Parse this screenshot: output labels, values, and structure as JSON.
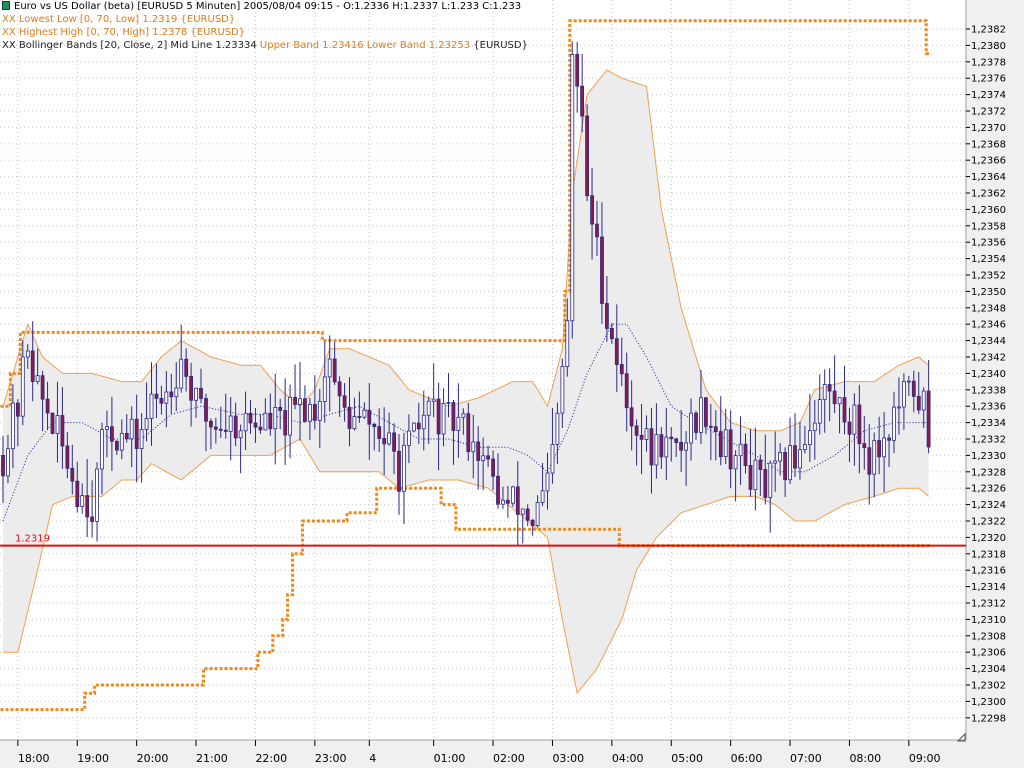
{
  "legend": {
    "title_line": "Euro vs US Dollar (beta) [EURUSD  5 Minuten] 2005/08/04 09:15 - O:1.2336 H:1.2337 L:1.233 C:1.233",
    "lowest_low": "Lowest Low [0, 70, Low] 1.2319 {EURUSD}",
    "highest_high": "Highest High [0, 70, High] 1.2378 {EURUSD}",
    "bollinger_prefix": "Bollinger Bands [20, Close, 2] Mid Line 1.23334 ",
    "bollinger_bands": "Upper Band 1.23416 Lower Band 1.23253",
    "bollinger_suffix": " {EURUSD}",
    "item_marker": "XX"
  },
  "colors": {
    "up_candle": "#ffffff",
    "down_candle": "#8b1a4a",
    "candle_wick": "#2a2a8a",
    "band_line": "#f0a050",
    "band_fill": "#ececec",
    "midline": "#1a1a9a",
    "channel": "#ee8a1a",
    "ref_line": "#e01010",
    "grid": "#c8c8c8",
    "axis_bg": "#f0f0f0"
  },
  "chart_data": {
    "type": "candlestick",
    "title": "Euro vs US Dollar (beta) [EURUSD  5 Minuten]",
    "ylim": [
      1.2296,
      1.2384
    ],
    "y_ticks": [
      1.2298,
      1.23,
      1.2302,
      1.2304,
      1.2306,
      1.2308,
      1.231,
      1.2312,
      1.2314,
      1.2316,
      1.2318,
      1.232,
      1.2322,
      1.2324,
      1.2326,
      1.2328,
      1.233,
      1.2332,
      1.2334,
      1.2336,
      1.2338,
      1.234,
      1.2342,
      1.2344,
      1.2346,
      1.2348,
      1.235,
      1.2352,
      1.2354,
      1.2356,
      1.2358,
      1.236,
      1.2362,
      1.2364,
      1.2366,
      1.2368,
      1.237,
      1.2372,
      1.2374,
      1.2376,
      1.2378,
      1.238,
      1.2382
    ],
    "y_tick_labels": [
      "1,2298",
      "1,2300",
      "1,2302",
      "1,2304",
      "1,2306",
      "1,2308",
      "1,2310",
      "1,2312",
      "1,2314",
      "1,2316",
      "1,2318",
      "1,2320",
      "1,2322",
      "1,2324",
      "1,2326",
      "1,2328",
      "1,2330",
      "1,2332",
      "1,2334",
      "1,2336",
      "1,2338",
      "1,2340",
      "1,2342",
      "1,2344",
      "1,2346",
      "1,2348",
      "1,2350",
      "1,2352",
      "1,2354",
      "1,2356",
      "1,2358",
      "1,2360",
      "1,2362",
      "1,2364",
      "1,2366",
      "1,2368",
      "1,2370",
      "1,2372",
      "1,2374",
      "1,2376",
      "1,2378",
      "1,2380",
      "1,2382"
    ],
    "x_ticks": [
      "18:00",
      "19:00",
      "20:00",
      "21:00",
      "22:00",
      "23:00",
      "4",
      "01:00",
      "02:00",
      "03:00",
      "04:00",
      "05:00",
      "06:00",
      "07:00",
      "08:00",
      "09:00"
    ],
    "x_tick_bars": [
      3,
      15,
      27,
      39,
      51,
      63,
      74,
      87,
      99,
      111,
      123,
      135,
      147,
      159,
      171,
      183
    ],
    "n_bars": 188,
    "reference_line": {
      "value": 1.2319,
      "label": "1.2319"
    },
    "anchors": {
      "close": [
        [
          0,
          1.233
        ],
        [
          3,
          1.2336
        ],
        [
          5,
          1.2344
        ],
        [
          7,
          1.2338
        ],
        [
          10,
          1.2334
        ],
        [
          15,
          1.2326
        ],
        [
          18,
          1.2324
        ],
        [
          21,
          1.2334
        ],
        [
          24,
          1.2332
        ],
        [
          27,
          1.2332
        ],
        [
          30,
          1.2336
        ],
        [
          33,
          1.2338
        ],
        [
          36,
          1.2342
        ],
        [
          39,
          1.2336
        ],
        [
          42,
          1.2334
        ],
        [
          45,
          1.2334
        ],
        [
          48,
          1.2334
        ],
        [
          51,
          1.2334
        ],
        [
          54,
          1.2334
        ],
        [
          57,
          1.2334
        ],
        [
          60,
          1.2336
        ],
        [
          63,
          1.2336
        ],
        [
          66,
          1.2342
        ],
        [
          68,
          1.2336
        ],
        [
          71,
          1.2334
        ],
        [
          74,
          1.2334
        ],
        [
          77,
          1.2332
        ],
        [
          80,
          1.2328
        ],
        [
          83,
          1.2332
        ],
        [
          86,
          1.2336
        ],
        [
          89,
          1.2334
        ],
        [
          92,
          1.2334
        ],
        [
          95,
          1.2332
        ],
        [
          98,
          1.2328
        ],
        [
          101,
          1.2324
        ],
        [
          104,
          1.2324
        ],
        [
          107,
          1.2322
        ],
        [
          110,
          1.2326
        ],
        [
          112,
          1.2334
        ],
        [
          114,
          1.2346
        ],
        [
          115,
          1.2378
        ],
        [
          116,
          1.2375
        ],
        [
          117,
          1.237
        ],
        [
          118,
          1.2362
        ],
        [
          120,
          1.2355
        ],
        [
          122,
          1.2347
        ],
        [
          124,
          1.2342
        ],
        [
          126,
          1.2336
        ],
        [
          128,
          1.2334
        ],
        [
          131,
          1.233
        ],
        [
          133,
          1.2332
        ],
        [
          136,
          1.233
        ],
        [
          139,
          1.2334
        ],
        [
          142,
          1.2336
        ],
        [
          145,
          1.2332
        ],
        [
          148,
          1.233
        ],
        [
          151,
          1.2328
        ],
        [
          154,
          1.2326
        ],
        [
          157,
          1.2328
        ],
        [
          160,
          1.233
        ],
        [
          163,
          1.2334
        ],
        [
          166,
          1.2338
        ],
        [
          169,
          1.2336
        ],
        [
          172,
          1.2334
        ],
        [
          175,
          1.233
        ],
        [
          178,
          1.2332
        ],
        [
          181,
          1.2336
        ],
        [
          184,
          1.2338
        ],
        [
          186,
          1.2336
        ],
        [
          187,
          1.233
        ]
      ],
      "upper_band": [
        [
          0,
          1.2336
        ],
        [
          3,
          1.2342
        ],
        [
          5,
          1.2346
        ],
        [
          8,
          1.2342
        ],
        [
          12,
          1.234
        ],
        [
          18,
          1.234
        ],
        [
          24,
          1.2339
        ],
        [
          28,
          1.2339
        ],
        [
          32,
          1.2342
        ],
        [
          36,
          1.2344
        ],
        [
          42,
          1.2342
        ],
        [
          48,
          1.2341
        ],
        [
          52,
          1.2341
        ],
        [
          56,
          1.2338
        ],
        [
          60,
          1.2336
        ],
        [
          63,
          1.2338
        ],
        [
          66,
          1.2343
        ],
        [
          70,
          1.2343
        ],
        [
          74,
          1.2342
        ],
        [
          78,
          1.2341
        ],
        [
          82,
          1.2338
        ],
        [
          86,
          1.2337
        ],
        [
          90,
          1.2336
        ],
        [
          96,
          1.2337
        ],
        [
          103,
          1.2339
        ],
        [
          107,
          1.2339
        ],
        [
          110,
          1.2336
        ],
        [
          113,
          1.2343
        ],
        [
          115,
          1.2362
        ],
        [
          118,
          1.2374
        ],
        [
          122,
          1.2377
        ],
        [
          125,
          1.2376
        ],
        [
          130,
          1.2375
        ],
        [
          133,
          1.236
        ],
        [
          137,
          1.2348
        ],
        [
          142,
          1.2338
        ],
        [
          147,
          1.2334
        ],
        [
          152,
          1.2333
        ],
        [
          157,
          1.2333
        ],
        [
          161,
          1.2334
        ],
        [
          164,
          1.2338
        ],
        [
          170,
          1.2339
        ],
        [
          176,
          1.2339
        ],
        [
          181,
          1.2341
        ],
        [
          185,
          1.2342
        ],
        [
          187,
          1.2341
        ]
      ],
      "lower_band": [
        [
          0,
          1.2306
        ],
        [
          3,
          1.2306
        ],
        [
          7,
          1.2316
        ],
        [
          10,
          1.2324
        ],
        [
          14,
          1.2325
        ],
        [
          20,
          1.2325
        ],
        [
          24,
          1.2327
        ],
        [
          27,
          1.2327
        ],
        [
          30,
          1.2329
        ],
        [
          36,
          1.2327
        ],
        [
          42,
          1.233
        ],
        [
          48,
          1.233
        ],
        [
          54,
          1.233
        ],
        [
          60,
          1.2332
        ],
        [
          64,
          1.2328
        ],
        [
          68,
          1.2328
        ],
        [
          72,
          1.2328
        ],
        [
          76,
          1.2328
        ],
        [
          80,
          1.2326
        ],
        [
          86,
          1.2327
        ],
        [
          92,
          1.2327
        ],
        [
          98,
          1.2326
        ],
        [
          102,
          1.2324
        ],
        [
          106,
          1.2322
        ],
        [
          110,
          1.232
        ],
        [
          113,
          1.231
        ],
        [
          116,
          1.2301
        ],
        [
          120,
          1.2304
        ],
        [
          125,
          1.231
        ],
        [
          128,
          1.2316
        ],
        [
          132,
          1.232
        ],
        [
          137,
          1.2323
        ],
        [
          142,
          1.2324
        ],
        [
          147,
          1.2325
        ],
        [
          152,
          1.2325
        ],
        [
          156,
          1.2324
        ],
        [
          160,
          1.2322
        ],
        [
          164,
          1.2322
        ],
        [
          170,
          1.2324
        ],
        [
          176,
          1.2325
        ],
        [
          181,
          1.2326
        ],
        [
          185,
          1.2326
        ],
        [
          187,
          1.2325
        ]
      ],
      "mid_line": [
        [
          0,
          1.2322
        ],
        [
          5,
          1.233
        ],
        [
          10,
          1.2334
        ],
        [
          16,
          1.2334
        ],
        [
          22,
          1.2332
        ],
        [
          28,
          1.2332
        ],
        [
          34,
          1.2335
        ],
        [
          40,
          1.2336
        ],
        [
          48,
          1.2335
        ],
        [
          54,
          1.2335
        ],
        [
          60,
          1.2334
        ],
        [
          66,
          1.2335
        ],
        [
          72,
          1.2336
        ],
        [
          78,
          1.2334
        ],
        [
          84,
          1.2332
        ],
        [
          90,
          1.2332
        ],
        [
          96,
          1.2331
        ],
        [
          102,
          1.2331
        ],
        [
          106,
          1.233
        ],
        [
          110,
          1.2328
        ],
        [
          114,
          1.2333
        ],
        [
          118,
          1.234
        ],
        [
          123,
          1.2346
        ],
        [
          126,
          1.2346
        ],
        [
          130,
          1.2342
        ],
        [
          135,
          1.2336
        ],
        [
          140,
          1.2334
        ],
        [
          146,
          1.2332
        ],
        [
          152,
          1.233
        ],
        [
          157,
          1.2328
        ],
        [
          162,
          1.2328
        ],
        [
          168,
          1.233
        ],
        [
          174,
          1.2333
        ],
        [
          180,
          1.2334
        ],
        [
          187,
          1.2334
        ]
      ]
    },
    "lowest_low_steps": [
      [
        0,
        1.2299
      ],
      [
        16,
        1.2299
      ],
      [
        17,
        1.2301
      ],
      [
        19,
        1.2302
      ],
      [
        38,
        1.2302
      ],
      [
        41,
        1.2304
      ],
      [
        50,
        1.2304
      ],
      [
        52,
        1.2306
      ],
      [
        55,
        1.2308
      ],
      [
        57,
        1.231
      ],
      [
        58,
        1.2313
      ],
      [
        59,
        1.2318
      ],
      [
        61,
        1.2322
      ],
      [
        69,
        1.2322
      ],
      [
        70,
        1.2323
      ],
      [
        75,
        1.2323
      ],
      [
        76,
        1.2326
      ],
      [
        86,
        1.2326
      ],
      [
        89,
        1.2324
      ],
      [
        92,
        1.2321
      ],
      [
        124,
        1.2321
      ],
      [
        125,
        1.2319
      ],
      [
        188,
        1.2319
      ]
    ],
    "highest_high_steps": [
      [
        0,
        1.2336
      ],
      [
        2,
        1.234
      ],
      [
        4,
        1.2345
      ],
      [
        5,
        1.2345
      ],
      [
        6,
        1.2345
      ],
      [
        63,
        1.2345
      ],
      [
        65,
        1.2344
      ],
      [
        113,
        1.2344
      ],
      [
        114,
        1.235
      ],
      [
        115,
        1.2383
      ],
      [
        186,
        1.2383
      ],
      [
        187,
        1.2379
      ]
    ]
  }
}
